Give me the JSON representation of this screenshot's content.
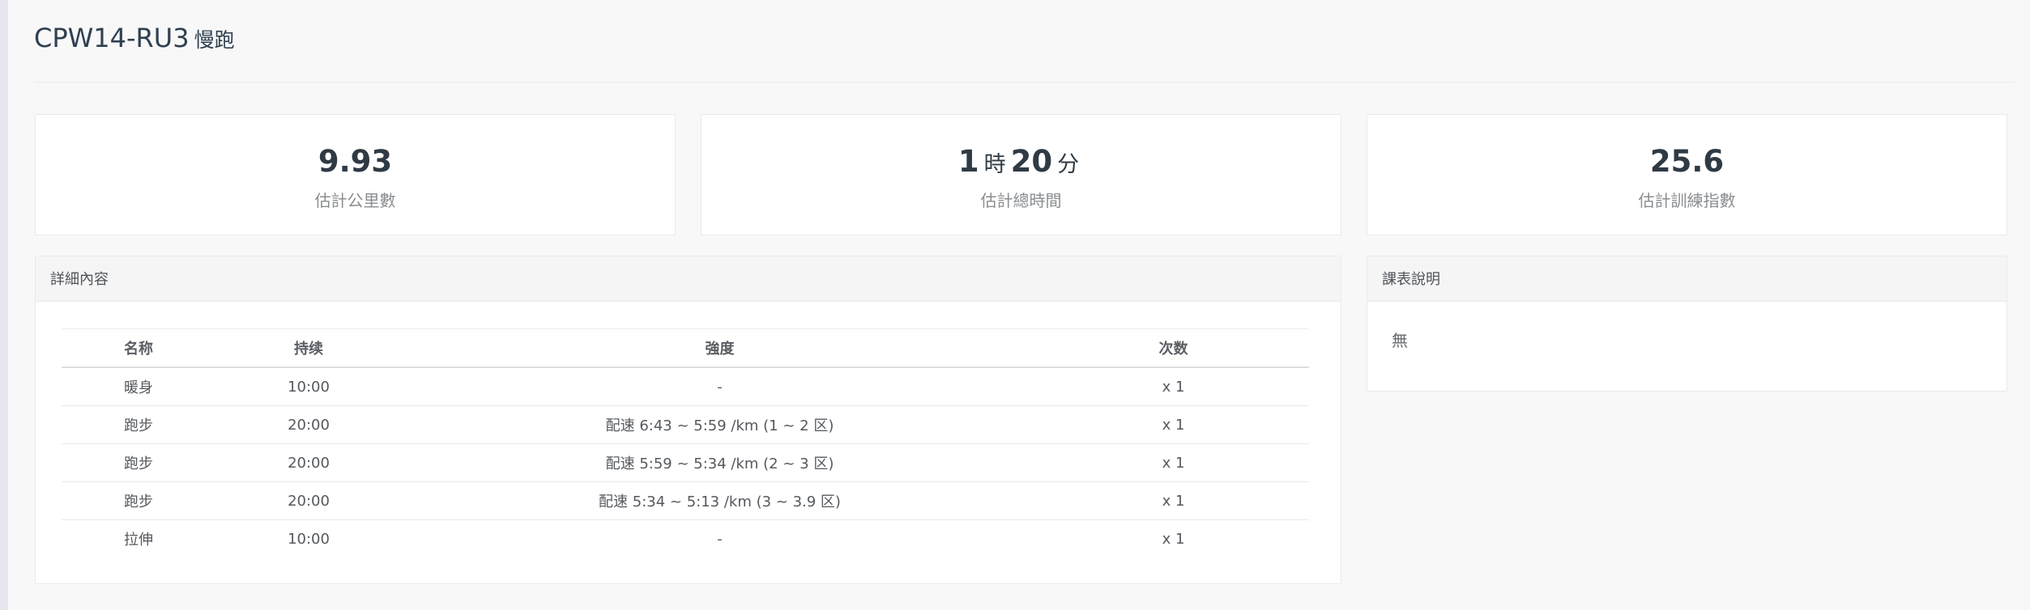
{
  "header": {
    "code": "CPW14-RU3",
    "name": "慢跑"
  },
  "stats": [
    {
      "value_parts": [
        "9.93"
      ],
      "label": "估計公里數"
    },
    {
      "hours": "1",
      "hours_unit": "時",
      "minutes": "20",
      "minutes_unit": "分",
      "label": "估計總時間"
    },
    {
      "value_parts": [
        "25.6"
      ],
      "label": "估計訓練指數"
    }
  ],
  "details": {
    "heading": "詳細內容",
    "columns": [
      "名称",
      "持续",
      "強度",
      "次数"
    ],
    "rows": [
      {
        "name": "暖身",
        "duration": "10:00",
        "intensity": "-",
        "count": "x 1"
      },
      {
        "name": "跑步",
        "duration": "20:00",
        "intensity": "配速 6:43 ~ 5:59 /km (1 ~ 2 区)",
        "count": "x 1"
      },
      {
        "name": "跑步",
        "duration": "20:00",
        "intensity": "配速 5:59 ~ 5:34 /km (2 ~ 3 区)",
        "count": "x 1"
      },
      {
        "name": "跑步",
        "duration": "20:00",
        "intensity": "配速 5:34 ~ 5:13 /km (3 ~ 3.9 区)",
        "count": "x 1"
      },
      {
        "name": "拉伸",
        "duration": "10:00",
        "intensity": "-",
        "count": "x 1"
      }
    ]
  },
  "notes": {
    "heading": "課表說明",
    "text": "無"
  }
}
